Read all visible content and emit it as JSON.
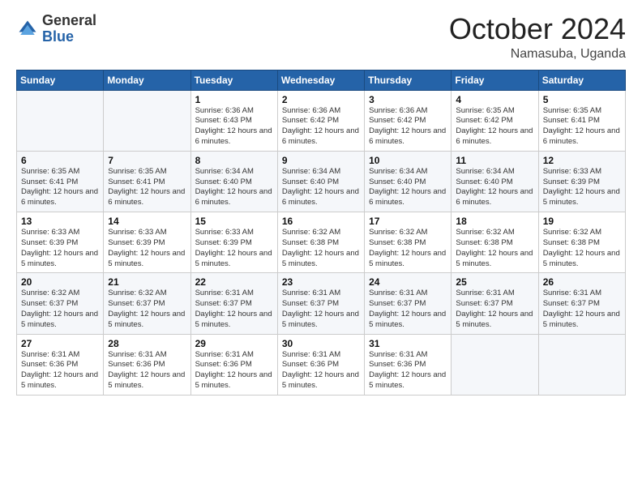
{
  "logo": {
    "general": "General",
    "blue": "Blue"
  },
  "header": {
    "month": "October 2024",
    "location": "Namasuba, Uganda"
  },
  "weekdays": [
    "Sunday",
    "Monday",
    "Tuesday",
    "Wednesday",
    "Thursday",
    "Friday",
    "Saturday"
  ],
  "weeks": [
    [
      {
        "day": "",
        "detail": ""
      },
      {
        "day": "",
        "detail": ""
      },
      {
        "day": "1",
        "detail": "Sunrise: 6:36 AM\nSunset: 6:43 PM\nDaylight: 12 hours and 6 minutes."
      },
      {
        "day": "2",
        "detail": "Sunrise: 6:36 AM\nSunset: 6:42 PM\nDaylight: 12 hours and 6 minutes."
      },
      {
        "day": "3",
        "detail": "Sunrise: 6:36 AM\nSunset: 6:42 PM\nDaylight: 12 hours and 6 minutes."
      },
      {
        "day": "4",
        "detail": "Sunrise: 6:35 AM\nSunset: 6:42 PM\nDaylight: 12 hours and 6 minutes."
      },
      {
        "day": "5",
        "detail": "Sunrise: 6:35 AM\nSunset: 6:41 PM\nDaylight: 12 hours and 6 minutes."
      }
    ],
    [
      {
        "day": "6",
        "detail": "Sunrise: 6:35 AM\nSunset: 6:41 PM\nDaylight: 12 hours and 6 minutes."
      },
      {
        "day": "7",
        "detail": "Sunrise: 6:35 AM\nSunset: 6:41 PM\nDaylight: 12 hours and 6 minutes."
      },
      {
        "day": "8",
        "detail": "Sunrise: 6:34 AM\nSunset: 6:40 PM\nDaylight: 12 hours and 6 minutes."
      },
      {
        "day": "9",
        "detail": "Sunrise: 6:34 AM\nSunset: 6:40 PM\nDaylight: 12 hours and 6 minutes."
      },
      {
        "day": "10",
        "detail": "Sunrise: 6:34 AM\nSunset: 6:40 PM\nDaylight: 12 hours and 6 minutes."
      },
      {
        "day": "11",
        "detail": "Sunrise: 6:34 AM\nSunset: 6:40 PM\nDaylight: 12 hours and 6 minutes."
      },
      {
        "day": "12",
        "detail": "Sunrise: 6:33 AM\nSunset: 6:39 PM\nDaylight: 12 hours and 5 minutes."
      }
    ],
    [
      {
        "day": "13",
        "detail": "Sunrise: 6:33 AM\nSunset: 6:39 PM\nDaylight: 12 hours and 5 minutes."
      },
      {
        "day": "14",
        "detail": "Sunrise: 6:33 AM\nSunset: 6:39 PM\nDaylight: 12 hours and 5 minutes."
      },
      {
        "day": "15",
        "detail": "Sunrise: 6:33 AM\nSunset: 6:39 PM\nDaylight: 12 hours and 5 minutes."
      },
      {
        "day": "16",
        "detail": "Sunrise: 6:32 AM\nSunset: 6:38 PM\nDaylight: 12 hours and 5 minutes."
      },
      {
        "day": "17",
        "detail": "Sunrise: 6:32 AM\nSunset: 6:38 PM\nDaylight: 12 hours and 5 minutes."
      },
      {
        "day": "18",
        "detail": "Sunrise: 6:32 AM\nSunset: 6:38 PM\nDaylight: 12 hours and 5 minutes."
      },
      {
        "day": "19",
        "detail": "Sunrise: 6:32 AM\nSunset: 6:38 PM\nDaylight: 12 hours and 5 minutes."
      }
    ],
    [
      {
        "day": "20",
        "detail": "Sunrise: 6:32 AM\nSunset: 6:37 PM\nDaylight: 12 hours and 5 minutes."
      },
      {
        "day": "21",
        "detail": "Sunrise: 6:32 AM\nSunset: 6:37 PM\nDaylight: 12 hours and 5 minutes."
      },
      {
        "day": "22",
        "detail": "Sunrise: 6:31 AM\nSunset: 6:37 PM\nDaylight: 12 hours and 5 minutes."
      },
      {
        "day": "23",
        "detail": "Sunrise: 6:31 AM\nSunset: 6:37 PM\nDaylight: 12 hours and 5 minutes."
      },
      {
        "day": "24",
        "detail": "Sunrise: 6:31 AM\nSunset: 6:37 PM\nDaylight: 12 hours and 5 minutes."
      },
      {
        "day": "25",
        "detail": "Sunrise: 6:31 AM\nSunset: 6:37 PM\nDaylight: 12 hours and 5 minutes."
      },
      {
        "day": "26",
        "detail": "Sunrise: 6:31 AM\nSunset: 6:37 PM\nDaylight: 12 hours and 5 minutes."
      }
    ],
    [
      {
        "day": "27",
        "detail": "Sunrise: 6:31 AM\nSunset: 6:36 PM\nDaylight: 12 hours and 5 minutes."
      },
      {
        "day": "28",
        "detail": "Sunrise: 6:31 AM\nSunset: 6:36 PM\nDaylight: 12 hours and 5 minutes."
      },
      {
        "day": "29",
        "detail": "Sunrise: 6:31 AM\nSunset: 6:36 PM\nDaylight: 12 hours and 5 minutes."
      },
      {
        "day": "30",
        "detail": "Sunrise: 6:31 AM\nSunset: 6:36 PM\nDaylight: 12 hours and 5 minutes."
      },
      {
        "day": "31",
        "detail": "Sunrise: 6:31 AM\nSunset: 6:36 PM\nDaylight: 12 hours and 5 minutes."
      },
      {
        "day": "",
        "detail": ""
      },
      {
        "day": "",
        "detail": ""
      }
    ]
  ]
}
